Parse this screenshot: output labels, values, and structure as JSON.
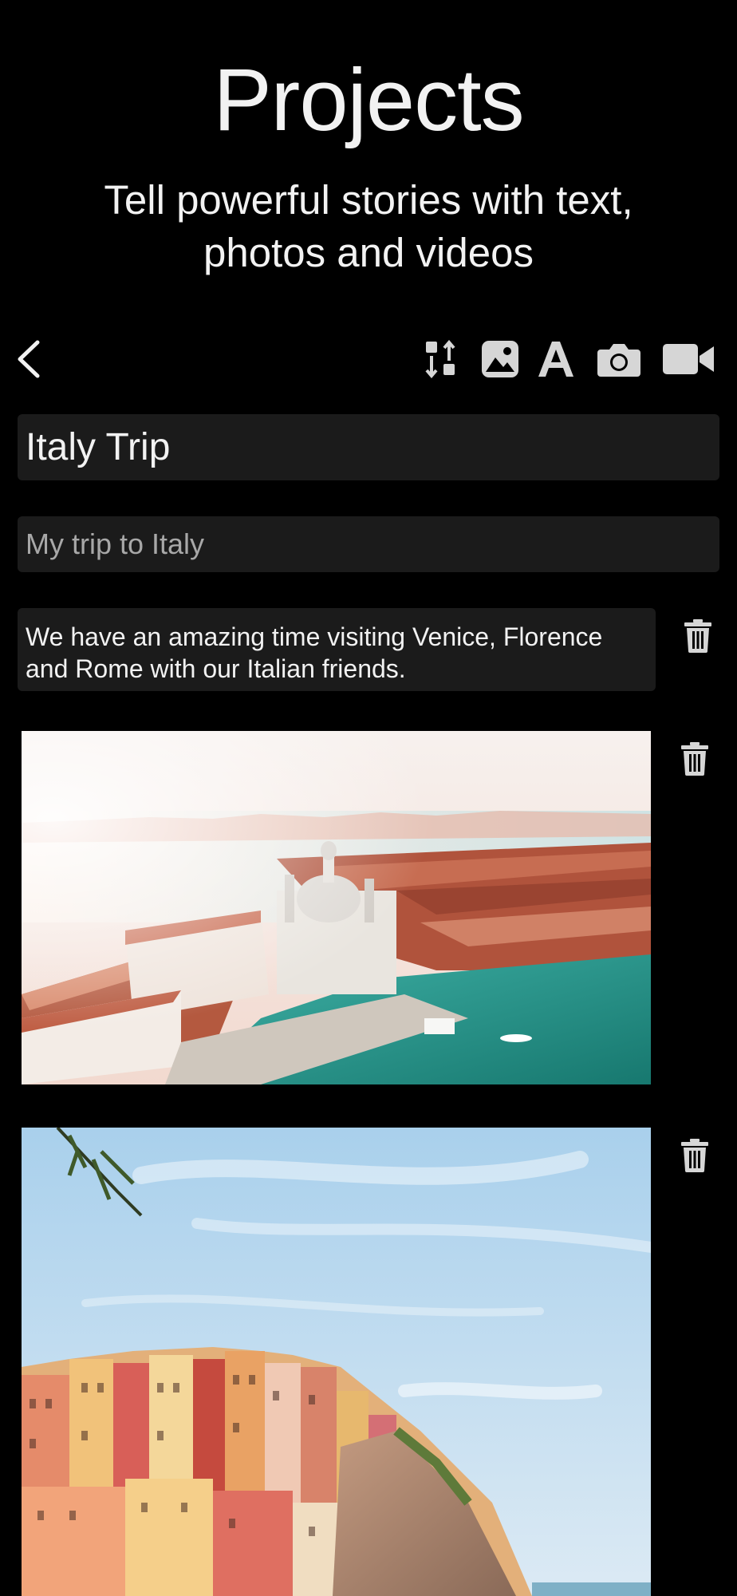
{
  "header": {
    "title": "Projects",
    "subtitle_line1": "Tell powerful stories with text,",
    "subtitle_line2": "photos and videos"
  },
  "toolbar": {
    "icons": [
      "back-chevron-icon",
      "reorder-icon",
      "image-icon",
      "text-icon",
      "camera-icon",
      "video-icon"
    ]
  },
  "project": {
    "title_value": "Italy Trip",
    "subtitle_placeholder": "My trip to Italy",
    "text_block": "We have an amazing time visiting Venice, Florence and Rome with our Italian friends."
  },
  "blocks": [
    {
      "type": "text",
      "icon": "trash-icon"
    },
    {
      "type": "photo",
      "depicts": "Venice aerial view",
      "icon": "trash-icon"
    },
    {
      "type": "photo",
      "depicts": "Cinque Terre cliffside village",
      "icon": "trash-icon"
    }
  ],
  "colors": {
    "background": "#000000",
    "field_background": "#1b1b1b",
    "text_primary": "#f2f2f2",
    "placeholder": "#a8a8a8",
    "icon": "#d6d6d6"
  }
}
